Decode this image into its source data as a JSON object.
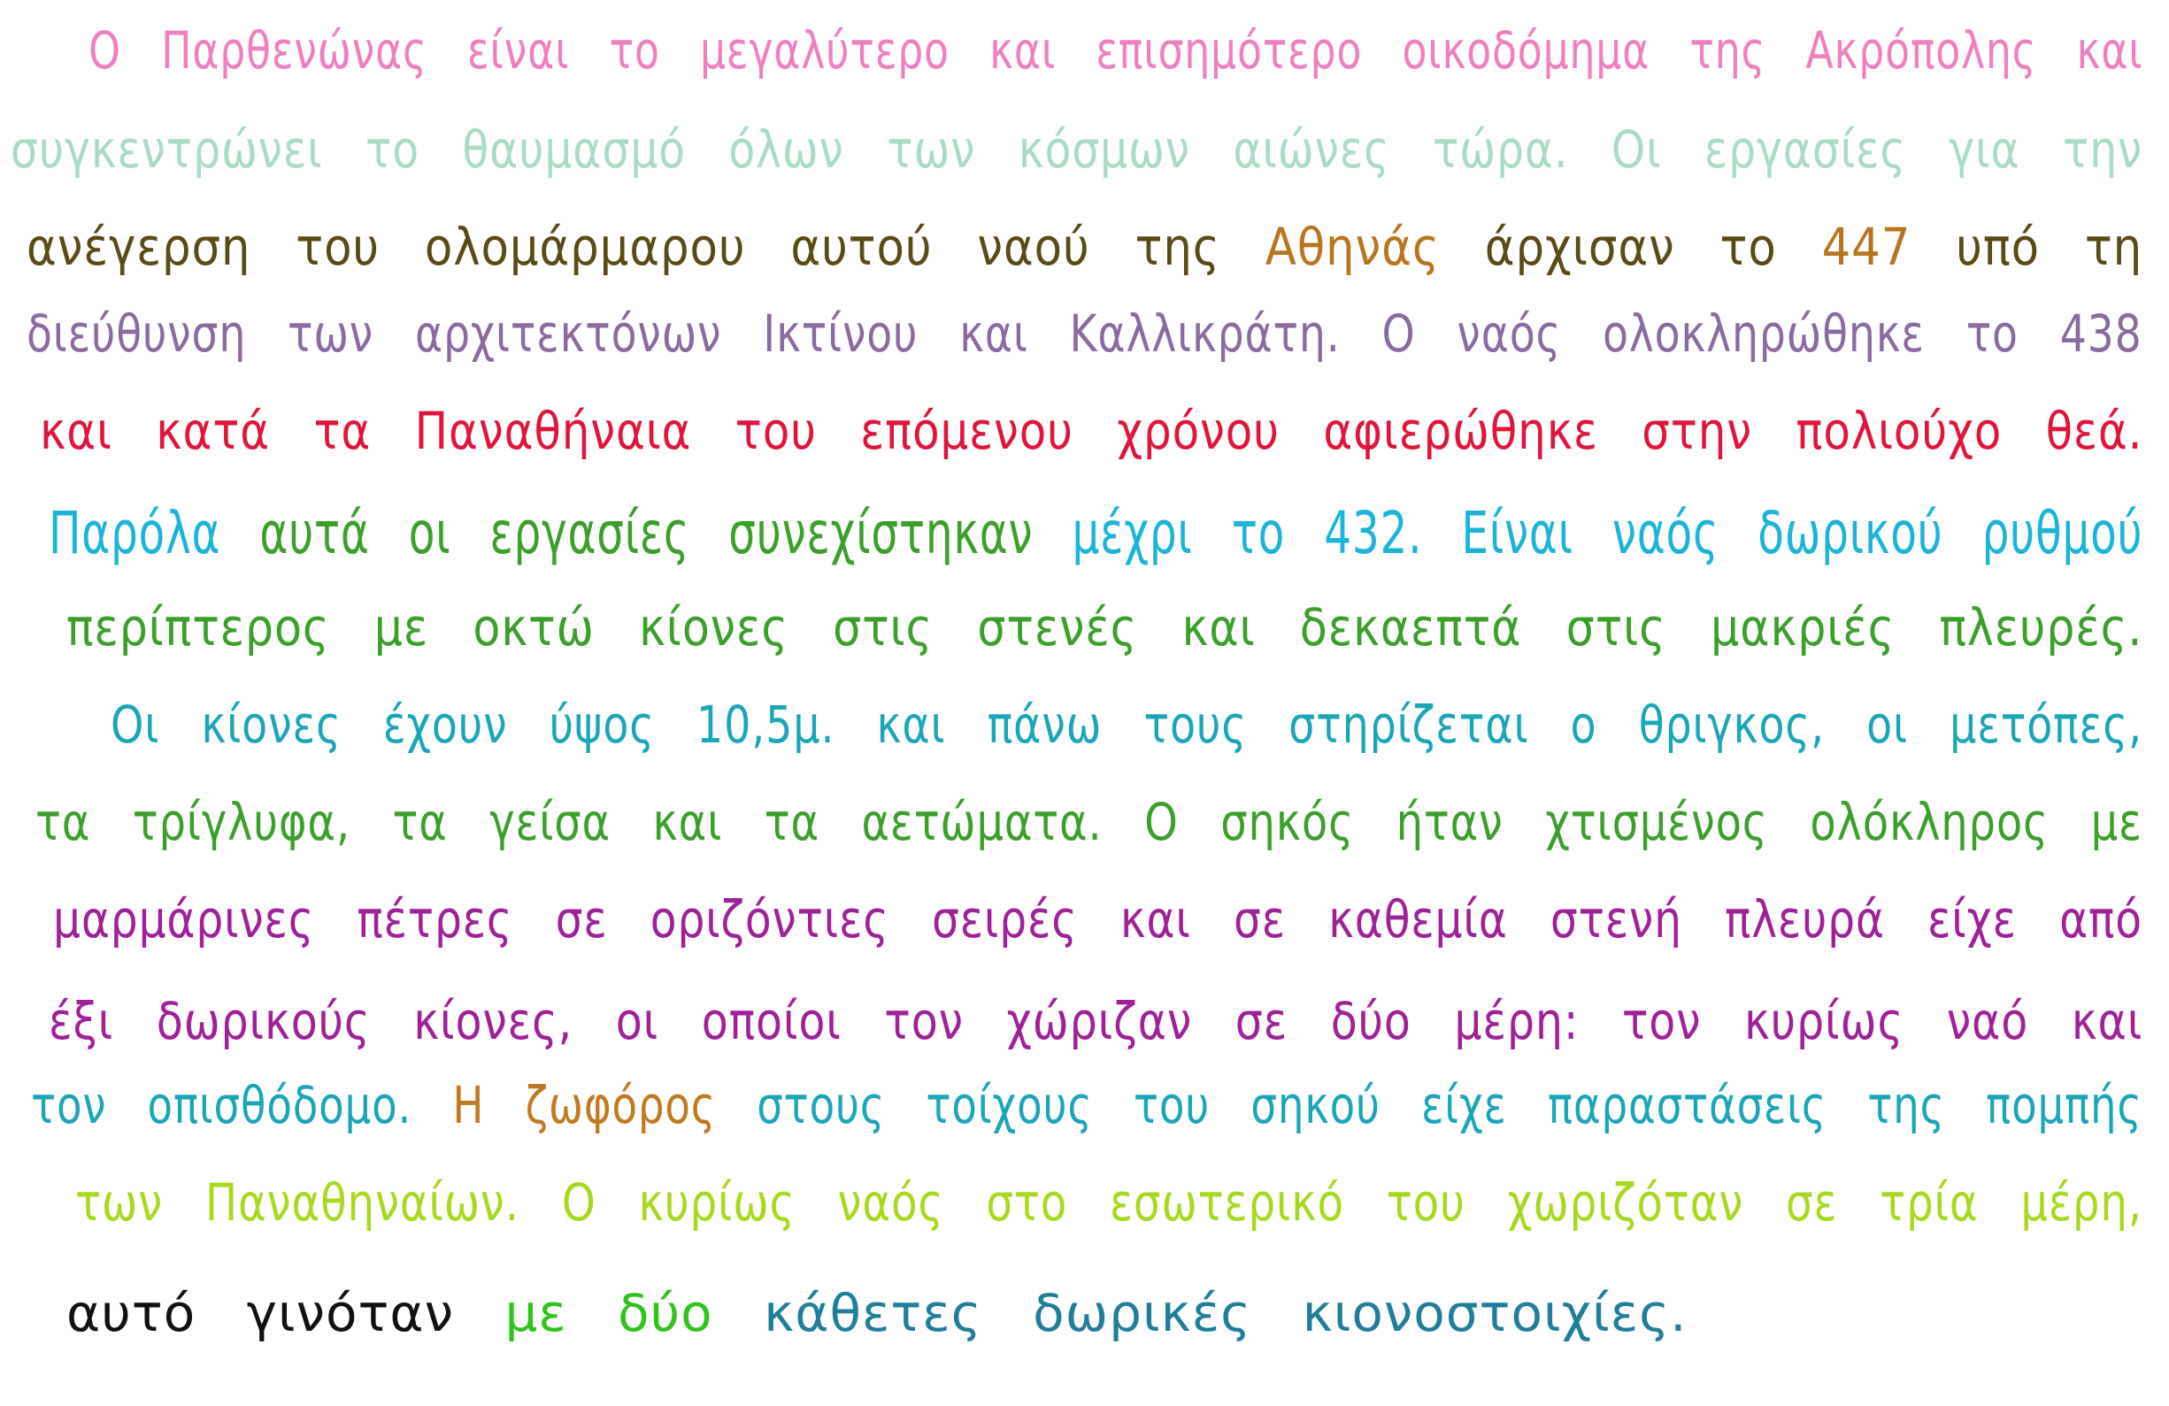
{
  "colors": {
    "pink": "#f07fc0",
    "mint": "#a8dcc4",
    "brown": "#7a4a1c",
    "olive": "#5a4a14",
    "amber": "#b8741e",
    "lavender": "#8a6aa0",
    "red": "#e0143c",
    "cyan": "#1ab4d8",
    "green": "#3aa02a",
    "teal": "#1aa6b8",
    "magenta": "#a0209a",
    "gold": "#c07a1e",
    "lime": "#a8d81e",
    "black": "#111111",
    "limegreen": "#2ec41a",
    "blue": "#1a6ab8",
    "steel": "#1f7f9a"
  },
  "lines": [
    {
      "segments": [
        {
          "text": "Ο Παρθενώνας είναι το μεγαλύτερο και επισημότερο οικοδόμημα της Ακρόπολης και",
          "color": "pink"
        }
      ]
    },
    {
      "segments": [
        {
          "text": "συγκεντρώνει το θαυμασμό όλων των κόσμων αιώνες τώρα. Οι εργασίες για την",
          "color": "mint"
        }
      ]
    },
    {
      "segments": [
        {
          "text": "ανέγερση του ολομάρμαρου αυτού ναού της ",
          "color": "olive"
        },
        {
          "text": "Αθηνάς",
          "color": "amber"
        },
        {
          "text": " άρχισαν το ",
          "color": "olive"
        },
        {
          "text": "447",
          "color": "amber"
        },
        {
          "text": " υπό τη",
          "color": "olive"
        }
      ]
    },
    {
      "segments": [
        {
          "text": "διεύθυνση των αρχιτεκτόνων Ικτίνου και Καλλικράτη. Ο ναός ολοκληρώθηκε το 438",
          "color": "lavender"
        }
      ]
    },
    {
      "segments": [
        {
          "text": "και κατά τα ",
          "color": "red"
        },
        {
          "text": "Παναθήναια",
          "color": "red"
        },
        {
          "text": " του επόμενου χρόνου αφιερώθηκε στην πολιούχο θεά.",
          "color": "red"
        }
      ]
    },
    {
      "segments": [
        {
          "text": "Παρόλα ",
          "color": "cyan"
        },
        {
          "text": "αυτά οι εργασίες συνεχίστηκαν ",
          "color": "green"
        },
        {
          "text": "μέχρι το 432. Είναι ναός δωρικού ρυθμού",
          "color": "cyan"
        }
      ]
    },
    {
      "segments": [
        {
          "text": "περίπτερος με οκτώ κίονες στις στενές και δεκαεπτά στις μακριές πλευρές.",
          "color": "green"
        }
      ]
    },
    {
      "segments": [
        {
          "text": "Οι κίονες έχουν ύψος 10,5μ. και πάνω τους στηρίζεται ο θριγκος, οι μετόπες,",
          "color": "teal"
        }
      ]
    },
    {
      "segments": [
        {
          "text": "τα τρίγλυφα, τα γείσα και τα αετώματα. Ο ",
          "color": "green"
        },
        {
          "text": "σηκός ήταν χτισμένος ολόκληρος με",
          "color": "green"
        }
      ]
    },
    {
      "segments": [
        {
          "text": "μαρμάρινες πέτρες σε οριζόντιες σειρές και σε καθεμία στενή πλευρά είχε από",
          "color": "magenta"
        }
      ]
    },
    {
      "segments": [
        {
          "text": "έξι δωρικούς κίονες, οι οποίοι τον χώριζαν σε δύο μέρη: τον κυρίως ναό και",
          "color": "magenta"
        }
      ]
    },
    {
      "segments": [
        {
          "text": "τον οπισθόδομο. ",
          "color": "teal"
        },
        {
          "text": "Η ζωφόρος",
          "color": "gold"
        },
        {
          "text": " στους τοίχους του σηκού είχε παραστάσεις της πομπής",
          "color": "teal"
        }
      ]
    },
    {
      "segments": [
        {
          "text": "των ",
          "color": "lime"
        },
        {
          "text": "Παναθηναίων.",
          "color": "lime"
        },
        {
          "text": " Ο κυρίως ναός στο εσωτερικό του χωριζόταν σε τρία μέρη,",
          "color": "lime"
        }
      ]
    },
    {
      "segments": [
        {
          "text": "αυτό γινόταν ",
          "color": "black"
        },
        {
          "text": "με δύο ",
          "color": "limegreen"
        },
        {
          "text": "κάθετες δωρικές κιονοστοιχίες.",
          "color": "steel"
        }
      ]
    }
  ]
}
